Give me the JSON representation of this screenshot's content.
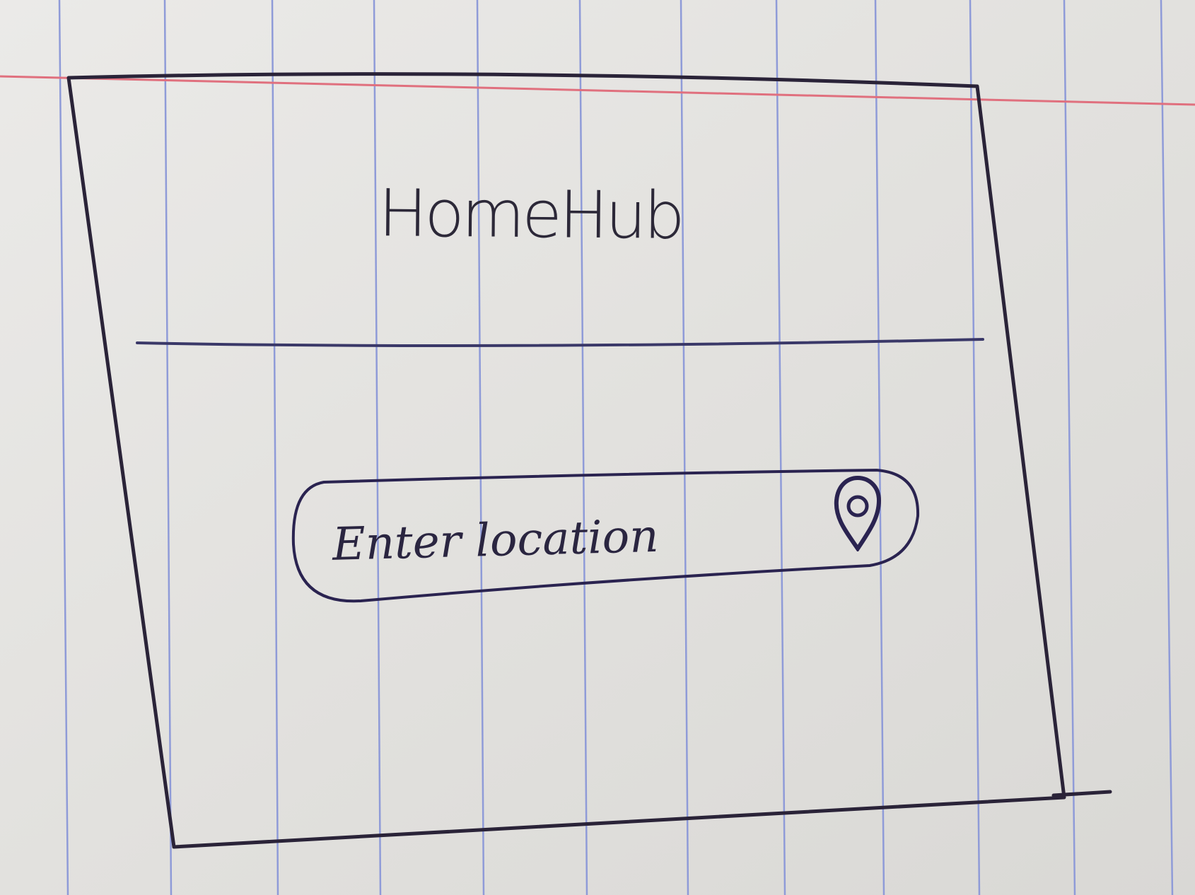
{
  "app": {
    "title": "HomeHub"
  },
  "location_search": {
    "placeholder": "Enter location",
    "icon": "map-pin-icon"
  },
  "colors": {
    "ink": "#2a2338",
    "paper": "#e4e3e0",
    "ruled_line": "#8f9bd8",
    "margin_line": "#e0707e"
  }
}
